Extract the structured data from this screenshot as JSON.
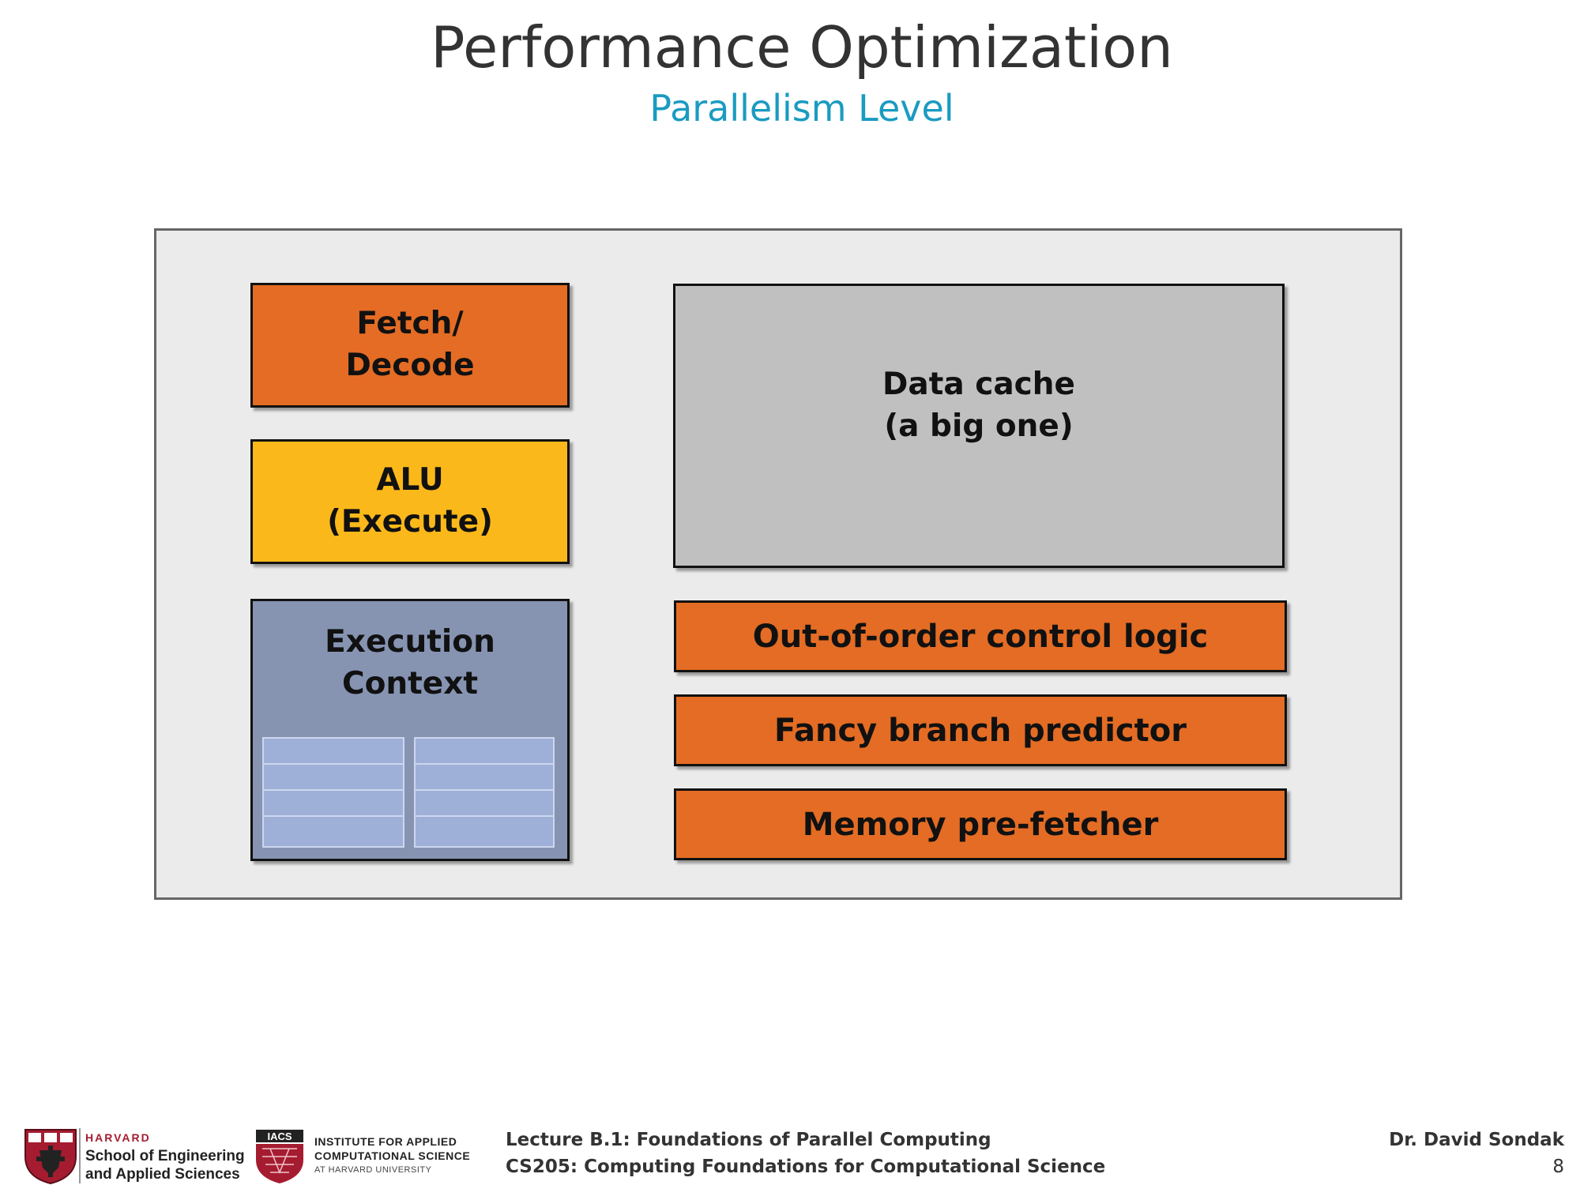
{
  "slide": {
    "title": "Performance Optimization",
    "subtitle": "Parallelism Level"
  },
  "diagram": {
    "fetch_decode": {
      "line1": "Fetch/",
      "line2": "Decode"
    },
    "alu": {
      "line1": "ALU",
      "line2": "(Execute)"
    },
    "execution_context": {
      "line1": "Execution",
      "line2": "Context"
    },
    "data_cache": {
      "line1": "Data cache",
      "line2": "(a big one)"
    },
    "ooo_logic": "Out-of-order control logic",
    "branch_predictor": "Fancy branch predictor",
    "prefetcher": "Memory pre-fetcher"
  },
  "footer": {
    "harvard_word": "HARVARD",
    "seas_line1": "School of Engineering",
    "seas_line2": "and Applied Sciences",
    "iacs_abbrev": "IACS",
    "iacs_line1": "INSTITUTE FOR APPLIED",
    "iacs_line2": "COMPUTATIONAL SCIENCE",
    "iacs_line3": "AT HARVARD UNIVERSITY",
    "lecture": "Lecture B.1: Foundations of Parallel Computing",
    "course": "CS205: Computing Foundations for Computational Science",
    "author": "Dr. David Sondak",
    "page": "8"
  },
  "colors": {
    "orange": "#e46c24",
    "yellow": "#fbb81a",
    "grey": "#c0c0c0",
    "blue": "#8694b2",
    "subtitle": "#1a9bc1",
    "harvard_crimson": "#a51c30"
  }
}
